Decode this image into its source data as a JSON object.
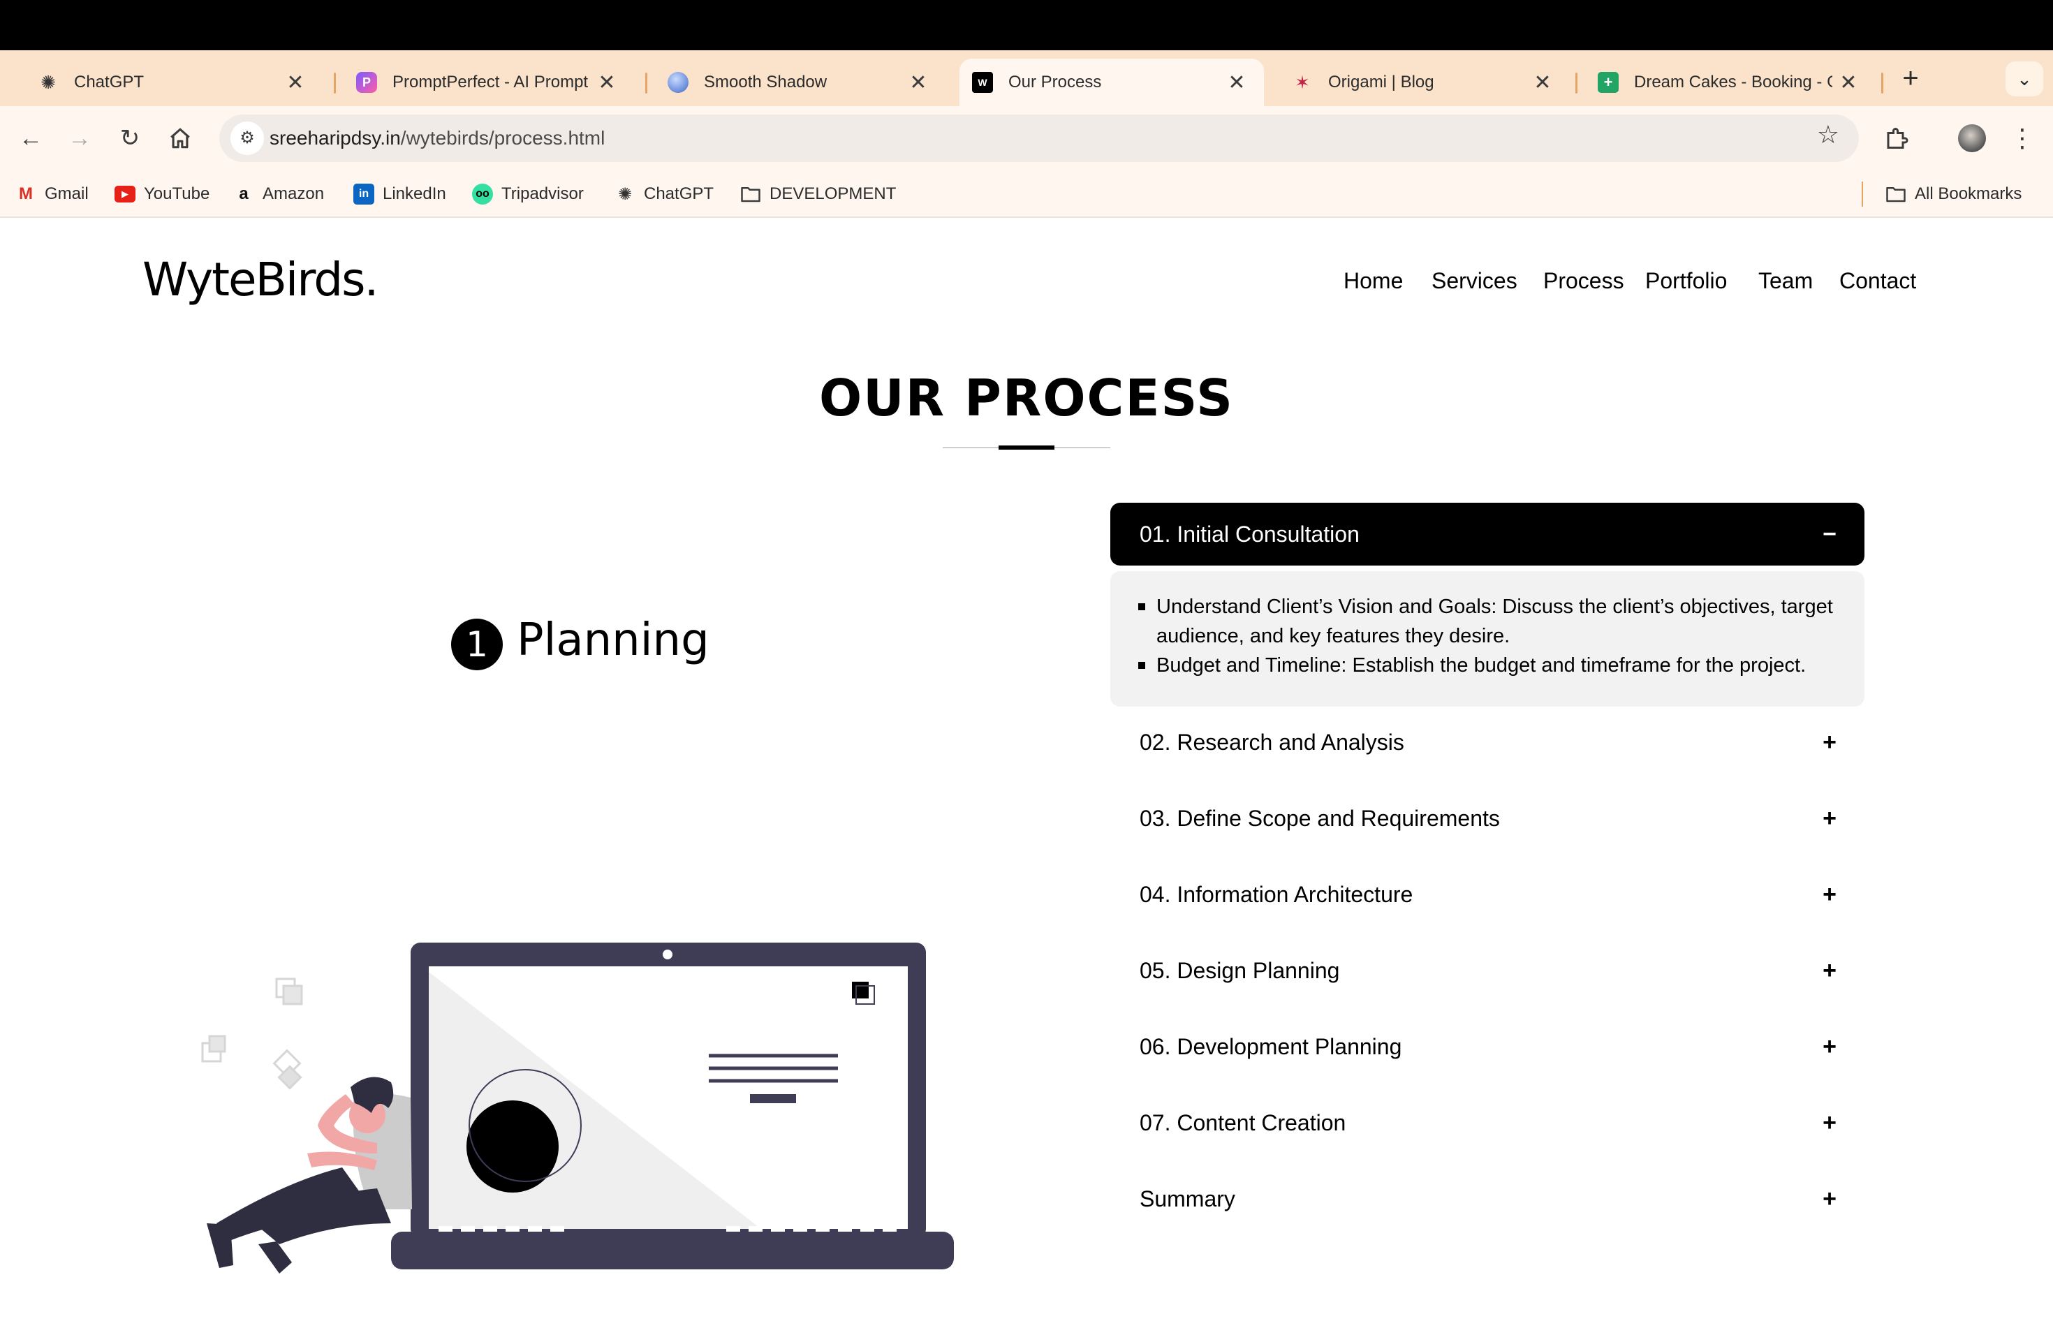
{
  "browser": {
    "tabs": [
      {
        "title": "ChatGPT",
        "icon": "chatgpt-icon"
      },
      {
        "title": "PromptPerfect - AI Prompt",
        "icon": "promptperfect-icon"
      },
      {
        "title": "Smooth Shadow",
        "icon": "smooth-shadow-icon"
      },
      {
        "title": "Our Process",
        "icon": "wytebirds-icon"
      },
      {
        "title": "Origami | Blog",
        "icon": "origami-icon"
      },
      {
        "title": "Dream Cakes - Booking - G",
        "icon": "google-sheets-icon"
      }
    ],
    "active_tab": 3,
    "new_tab_glyph": "+",
    "close_glyph": "✕",
    "tab_menu_glyph": "⌄",
    "url_host": "sreeharipdsy.in",
    "url_path": "/wytebirds/process.html",
    "bookmarks": [
      {
        "label": "Gmail",
        "icon": "gmail-icon"
      },
      {
        "label": "YouTube",
        "icon": "youtube-icon"
      },
      {
        "label": "Amazon",
        "icon": "amazon-icon"
      },
      {
        "label": "LinkedIn",
        "icon": "linkedin-icon"
      },
      {
        "label": "Tripadvisor",
        "icon": "tripadvisor-icon"
      },
      {
        "label": "ChatGPT",
        "icon": "chatgpt-icon"
      },
      {
        "label": "DEVELOPMENT",
        "icon": "folder-icon"
      }
    ],
    "all_bookmarks": "All Bookmarks"
  },
  "site": {
    "logo": "WyteBirds.",
    "nav": [
      "Home",
      "Services",
      "Process",
      "Portfolio",
      "Team",
      "Contact"
    ],
    "heading": "OUR PROCESS",
    "step_number": "1",
    "step_title": "Planning",
    "accordion": [
      {
        "label": "01. Initial Consultation",
        "sign": "−",
        "open": true
      },
      {
        "label": "02. Research and Analysis",
        "sign": "+",
        "open": false
      },
      {
        "label": "03. Define Scope and Requirements",
        "sign": "+",
        "open": false
      },
      {
        "label": "04. Information Architecture",
        "sign": "+",
        "open": false
      },
      {
        "label": "05. Design Planning",
        "sign": "+",
        "open": false
      },
      {
        "label": "06. Development Planning",
        "sign": "+",
        "open": false
      },
      {
        "label": "07. Content Creation",
        "sign": "+",
        "open": false
      },
      {
        "label": "Summary",
        "sign": "+",
        "open": false
      }
    ],
    "open_item_points": [
      "Understand Client’s Vision and Goals: Discuss the client’s objectives, target audience, and key features they desire.",
      "Budget and Timeline: Establish the budget and timeframe for the project."
    ]
  },
  "colors": {
    "tabstrip": "#fbe3cb",
    "toolbar": "#fff7ef",
    "laptop": "#3f3d56",
    "accent_black": "#000000"
  }
}
